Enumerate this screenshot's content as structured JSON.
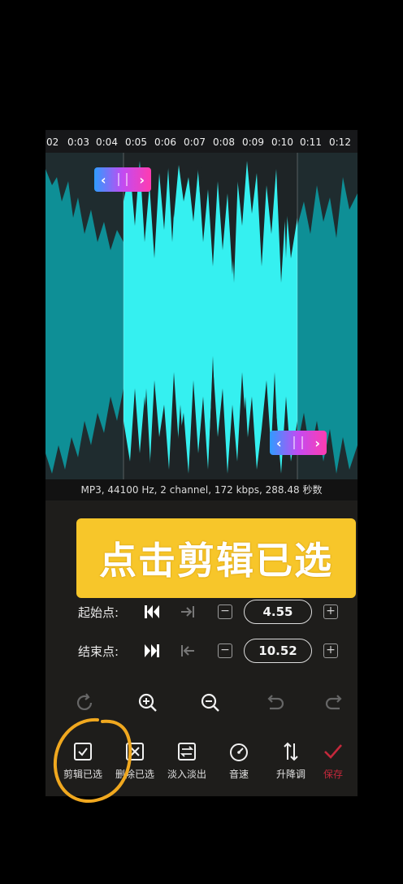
{
  "timeline": {
    "ticks": [
      "02",
      "0:03",
      "0:04",
      "0:05",
      "0:06",
      "0:07",
      "0:08",
      "0:09",
      "0:10",
      "0:11",
      "0:12"
    ]
  },
  "file_info": "MP3, 44100 Hz, 2 channel, 172 kbps, 288.48 秒数",
  "banner_text": "点击剪辑已选",
  "start": {
    "label": "起始点:",
    "value": "4.55"
  },
  "end": {
    "label": "结束点:",
    "value": "10.52"
  },
  "toolbar": {
    "items": [
      {
        "label": "剪辑已选",
        "icon": "check-square-icon"
      },
      {
        "label": "删除已选",
        "icon": "x-square-icon"
      },
      {
        "label": "淡入淡出",
        "icon": "fade-icon"
      },
      {
        "label": "音速",
        "icon": "speedometer-icon"
      },
      {
        "label": "升降调",
        "icon": "pitch-arrows-icon"
      },
      {
        "label": "保存",
        "icon": "save-check-icon"
      }
    ]
  },
  "colors": {
    "wave_selected": "#35f0f0",
    "wave_unselected": "#0e8f96",
    "banner": "#f7c62a",
    "save_accent": "#c4283b"
  }
}
